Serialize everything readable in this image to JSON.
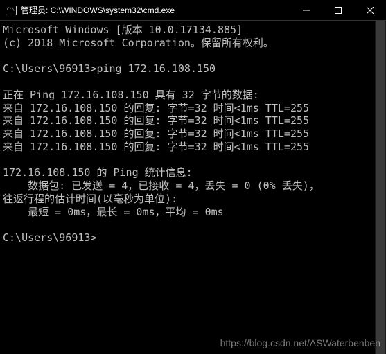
{
  "titlebar": {
    "title": "管理员: C:\\WINDOWS\\system32\\cmd.exe"
  },
  "terminal": {
    "lines": [
      "Microsoft Windows [版本 10.0.17134.885]",
      "(c) 2018 Microsoft Corporation。保留所有权利。",
      "",
      "C:\\Users\\96913>ping 172.16.108.150",
      "",
      "正在 Ping 172.16.108.150 具有 32 字节的数据:",
      "来自 172.16.108.150 的回复: 字节=32 时间<1ms TTL=255",
      "来自 172.16.108.150 的回复: 字节=32 时间<1ms TTL=255",
      "来自 172.16.108.150 的回复: 字节=32 时间<1ms TTL=255",
      "来自 172.16.108.150 的回复: 字节=32 时间<1ms TTL=255",
      "",
      "172.16.108.150 的 Ping 统计信息:",
      "    数据包: 已发送 = 4，已接收 = 4，丢失 = 0 (0% 丢失)，",
      "往返行程的估计时间(以毫秒为单位):",
      "    最短 = 0ms，最长 = 0ms，平均 = 0ms",
      "",
      "C:\\Users\\96913>"
    ]
  },
  "watermark": "https://blog.csdn.net/ASWaterbenben"
}
